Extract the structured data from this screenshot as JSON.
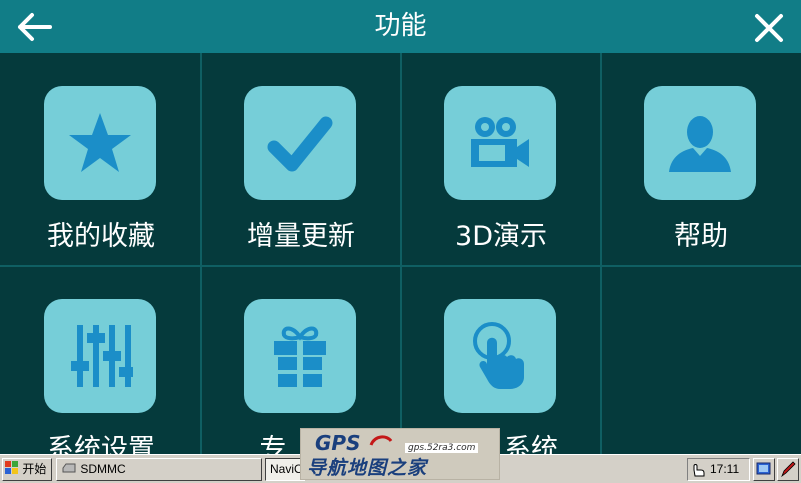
{
  "header": {
    "title": "功能",
    "back_icon": "back-arrow-icon",
    "close_icon": "close-icon",
    "bg_color": "#117d87"
  },
  "colors": {
    "background": "#053a3c",
    "tile": "#76ced8",
    "icon": "#1b8ec8",
    "divider": "#0f5f63"
  },
  "menu": {
    "items": [
      {
        "label": "我的收藏",
        "icon": "star-icon"
      },
      {
        "label": "增量更新",
        "icon": "checkmark-icon"
      },
      {
        "label": "3D演示",
        "icon": "video-camera-icon"
      },
      {
        "label": "帮助",
        "icon": "person-icon"
      },
      {
        "label": "系统设置",
        "icon": "sliders-icon"
      },
      {
        "label": "专",
        "icon": "gift-icon"
      },
      {
        "label": "系统",
        "icon": "touch-hand-icon"
      }
    ]
  },
  "taskbar": {
    "start_label": "开始",
    "task1_label": "SDMMC",
    "task2_label": "NaviO",
    "clock": "17:11"
  },
  "watermark": {
    "brand": "GPS",
    "url": "gps.52ra3.com",
    "slogan": "导航地图之家"
  }
}
